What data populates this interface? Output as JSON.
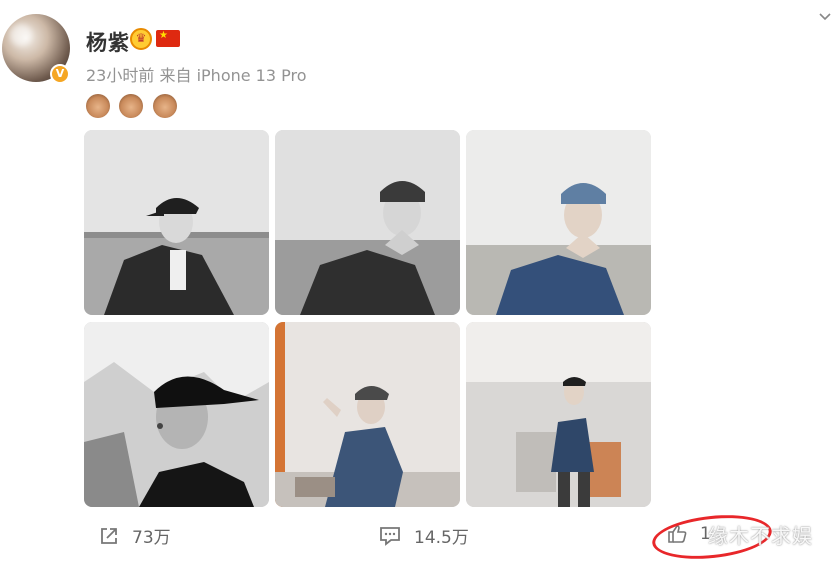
{
  "user": {
    "name": "杨紫",
    "verified_mark": "V",
    "crown_icon": "crown-badge-icon",
    "flag_icon": "china-flag-icon"
  },
  "post": {
    "time": "23小时前",
    "source_prefix": "来自",
    "device": "iPhone 13 Pro",
    "emojis": [
      "monkey-hands-on-eyes-emoji",
      "monkey-hands-on-mouth-emoji",
      "monkey-hands-on-ears-emoji"
    ]
  },
  "photos": [
    {
      "name": "photo-1",
      "tone": "grayscale"
    },
    {
      "name": "photo-2",
      "tone": "grayscale"
    },
    {
      "name": "photo-3",
      "tone": "blue-denim"
    },
    {
      "name": "photo-4",
      "tone": "grayscale"
    },
    {
      "name": "photo-5",
      "tone": "blue-denim"
    },
    {
      "name": "photo-6",
      "tone": "blue-denim"
    }
  ],
  "actions": {
    "share_count": "73万",
    "comment_count": "14.5万",
    "like_count": "1"
  },
  "watermark": "缘木不求娱",
  "colors": {
    "highlight_circle": "#e8272a",
    "meta_text": "#939393"
  }
}
